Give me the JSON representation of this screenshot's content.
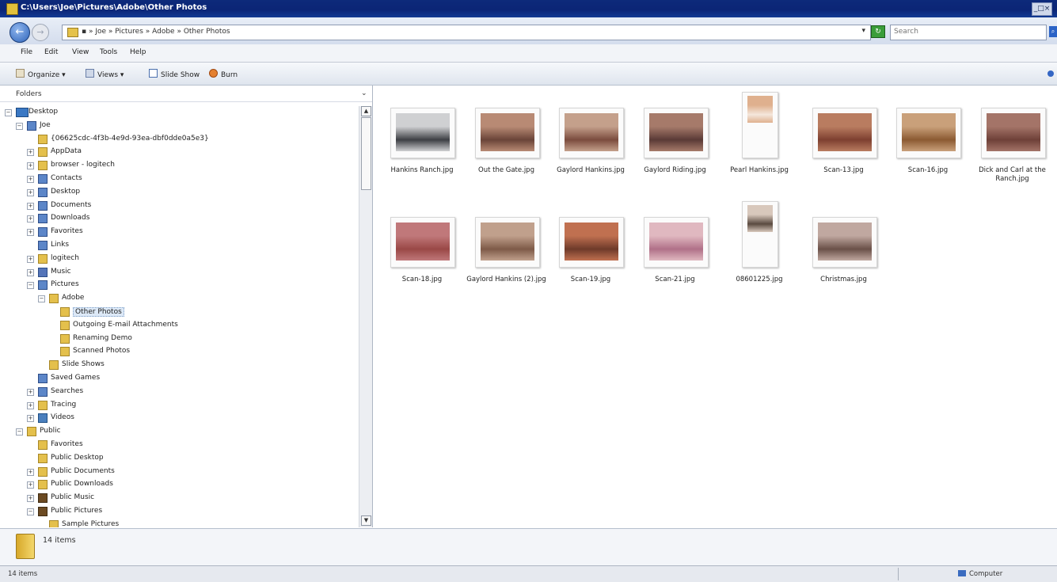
{
  "window": {
    "title": "C:\\Users\\Joe\\Pictures\\Adobe\\Other Photos",
    "controls": "_□×"
  },
  "navigation": {
    "back_icon": "back-arrow-icon",
    "forward_icon": "forward-arrow-icon",
    "breadcrumb": "▪ » Joe » Pictures » Adobe » Other Photos",
    "dropdown": "▾",
    "refresh_icon": "refresh-icon",
    "search_placeholder": "Search",
    "search_icon": "search-icon"
  },
  "menubar": {
    "items": [
      "File",
      "Edit",
      "View",
      "Tools",
      "Help"
    ]
  },
  "toolbar": {
    "organize": "Organize ▾",
    "views": "Views ▾",
    "slideshow": "Slide Show",
    "burn": "Burn"
  },
  "left_pane": {
    "header": "Folders",
    "chevron": "⌄"
  },
  "tree": [
    {
      "label": "Desktop",
      "depth": 0,
      "expander": "−",
      "icon": "desktop"
    },
    {
      "label": "Joe",
      "depth": 1,
      "expander": "−",
      "icon": "special"
    },
    {
      "label": "{06625cdc-4f3b-4e9d-93ea-dbf0dde0a5e3}",
      "depth": 2,
      "expander": "",
      "icon": "folder"
    },
    {
      "label": "AppData",
      "depth": 2,
      "expander": "+",
      "icon": "folder"
    },
    {
      "label": "browser - logitech",
      "depth": 2,
      "expander": "+",
      "icon": "folder"
    },
    {
      "label": "Contacts",
      "depth": 2,
      "expander": "+",
      "icon": "special"
    },
    {
      "label": "Desktop",
      "depth": 2,
      "expander": "+",
      "icon": "special"
    },
    {
      "label": "Documents",
      "depth": 2,
      "expander": "+",
      "icon": "special"
    },
    {
      "label": "Downloads",
      "depth": 2,
      "expander": "+",
      "icon": "special"
    },
    {
      "label": "Favorites",
      "depth": 2,
      "expander": "+",
      "icon": "special"
    },
    {
      "label": "Links",
      "depth": 2,
      "expander": "",
      "icon": "special"
    },
    {
      "label": "logitech",
      "depth": 2,
      "expander": "+",
      "icon": "folder"
    },
    {
      "label": "Music",
      "depth": 2,
      "expander": "+",
      "icon": "music"
    },
    {
      "label": "Pictures",
      "depth": 2,
      "expander": "−",
      "icon": "special"
    },
    {
      "label": "Adobe",
      "depth": 3,
      "expander": "−",
      "icon": "folder"
    },
    {
      "label": "Other Photos",
      "depth": 4,
      "expander": "",
      "icon": "folder",
      "selected": true
    },
    {
      "label": "Outgoing E-mail Attachments",
      "depth": 4,
      "expander": "",
      "icon": "folder"
    },
    {
      "label": "Renaming Demo",
      "depth": 4,
      "expander": "",
      "icon": "folder"
    },
    {
      "label": "Scanned Photos",
      "depth": 4,
      "expander": "",
      "icon": "folder"
    },
    {
      "label": "Slide Shows",
      "depth": 3,
      "expander": "",
      "icon": "folder"
    },
    {
      "label": "Saved Games",
      "depth": 2,
      "expander": "",
      "icon": "special"
    },
    {
      "label": "Searches",
      "depth": 2,
      "expander": "+",
      "icon": "special"
    },
    {
      "label": "Tracing",
      "depth": 2,
      "expander": "+",
      "icon": "folder"
    },
    {
      "label": "Videos",
      "depth": 2,
      "expander": "+",
      "icon": "video"
    },
    {
      "label": "Public",
      "depth": 1,
      "expander": "−",
      "icon": "folder"
    },
    {
      "label": "Favorites",
      "depth": 2,
      "expander": "",
      "icon": "folder"
    },
    {
      "label": "Public Desktop",
      "depth": 2,
      "expander": "",
      "icon": "folder"
    },
    {
      "label": "Public Documents",
      "depth": 2,
      "expander": "+",
      "icon": "folder"
    },
    {
      "label": "Public Downloads",
      "depth": 2,
      "expander": "+",
      "icon": "folder"
    },
    {
      "label": "Public Music",
      "depth": 2,
      "expander": "+",
      "icon": "dark"
    },
    {
      "label": "Public Pictures",
      "depth": 2,
      "expander": "−",
      "icon": "dark"
    },
    {
      "label": "Sample Pictures",
      "depth": 3,
      "expander": "",
      "icon": "folder"
    }
  ],
  "files": [
    {
      "name": "Hankins Ranch.jpg",
      "colors": [
        "#cfd0d2",
        "#3d3f44"
      ]
    },
    {
      "name": "Out the Gate.jpg",
      "colors": [
        "#b88a74",
        "#6a4438"
      ]
    },
    {
      "name": "Gaylord Hankins.jpg",
      "colors": [
        "#c4a08b",
        "#7b4c3e"
      ]
    },
    {
      "name": "Gaylord Riding.jpg",
      "colors": [
        "#a67a6a",
        "#5a3a36"
      ]
    },
    {
      "name": "Pearl Hankins.jpg",
      "colors": [
        "#dfb08e",
        "#f4e7dc"
      ]
    },
    {
      "name": "Scan-13.jpg",
      "colors": [
        "#b97c60",
        "#7d3f30"
      ]
    },
    {
      "name": "Scan-16.jpg",
      "colors": [
        "#c9a07a",
        "#8b5a32"
      ]
    },
    {
      "name": "Dick and Carl at the Ranch.jpg",
      "colors": [
        "#a47468",
        "#6e4038"
      ]
    },
    {
      "name": "Scan-18.jpg",
      "colors": [
        "#c0787a",
        "#9a4846"
      ]
    },
    {
      "name": "Gaylord Hankins (2).jpg",
      "colors": [
        "#c0a08c",
        "#7e5a48"
      ]
    },
    {
      "name": "Scan-19.jpg",
      "colors": [
        "#c07050",
        "#6e3a2a"
      ]
    },
    {
      "name": "Scan-21.jpg",
      "colors": [
        "#e0b8c0",
        "#b07088"
      ]
    },
    {
      "name": "08601225.jpg",
      "colors": [
        "#d8c8bc",
        "#5a4a40"
      ]
    },
    {
      "name": "Christmas.jpg",
      "colors": [
        "#c0a8a0",
        "#6a5048"
      ]
    }
  ],
  "details": {
    "count": "14 items"
  },
  "status": {
    "left": "14 items",
    "right": "Computer"
  }
}
